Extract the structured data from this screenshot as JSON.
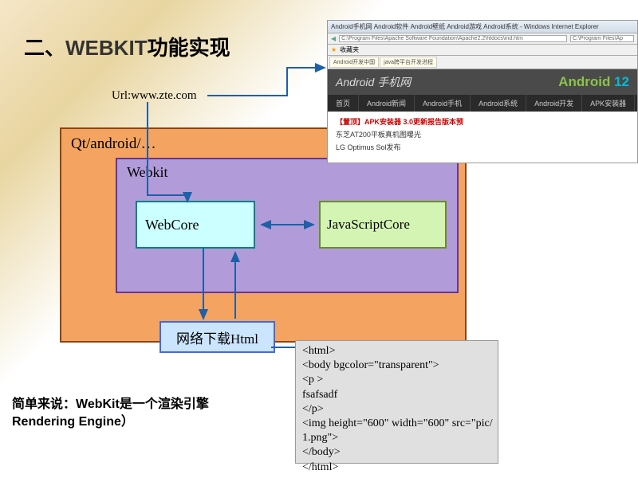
{
  "title_prefix": "二、",
  "title_main": "WEBKIT",
  "title_suffix": "功能实现",
  "url_label": "Url:www.zte.com",
  "qt_label": "Qt/android/…",
  "webkit_label": "Webkit",
  "webcore_label": "WebCore",
  "jscore_label": "JavaScriptCore",
  "network_label": "网络下载Html",
  "code_sample": "<html>\n<body bgcolor=\"transparent\">\n<p >\nfsafsadf\n</p>\n<img height=\"600\" width=\"600\" src=\"pic/\n1.png\">\n</body>\n</html>",
  "caption_line1": "简单来说：WebKit是一个渲染引擎",
  "caption_line2": "Rendering Engine）",
  "browser": {
    "menu": "Android手机网 Android软件 Android壁纸 Android游戏 Android系统 - Windows Internet Explorer",
    "addr1": "C:\\Program Files\\Apache Software Foundation\\Apache2.2\\htdocs\\ind.htm",
    "addr2": "C:\\Program Files\\Ap",
    "tab1": "Android开发中国",
    "tab2": "java跨平台开发进程",
    "fav": "收藏夹",
    "site_title": "Android 手机网",
    "logo_text": "Android",
    "logo_num": " 12",
    "nav": [
      "首页",
      "Android新闻",
      "Android手机",
      "Android系统",
      "Android开发",
      "APK安装器"
    ],
    "red": "【置顶】APK安装器 3.0更新报告版本预",
    "line1": "东芝AT200平板真机图曝光",
    "line2": "LG Optimus Sol发布"
  }
}
